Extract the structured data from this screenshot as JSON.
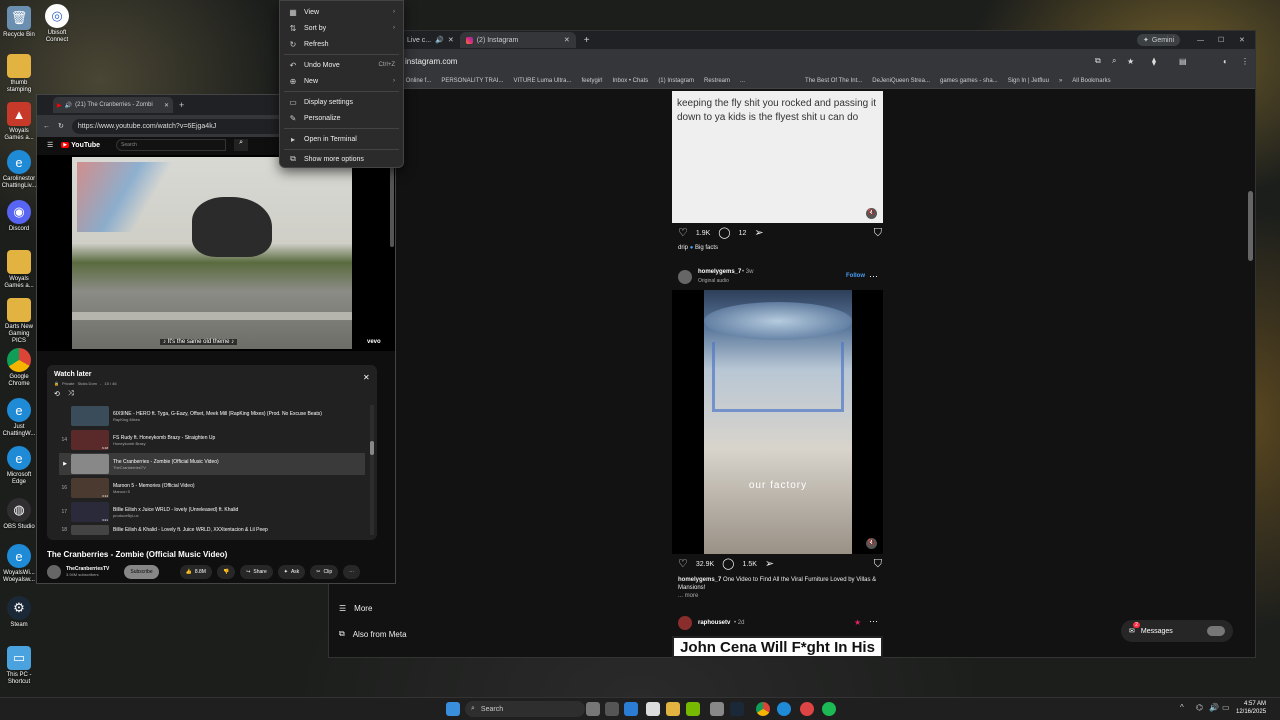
{
  "desktop": {
    "icons": [
      {
        "label": "Recycle Bin"
      },
      {
        "label": "thumb\nstamping"
      },
      {
        "label": "Woyals\nGames a..."
      },
      {
        "label": "Carolinestor\nChattingLiv..."
      },
      {
        "label": "Discord"
      },
      {
        "label": "Woyals\nGames a..."
      },
      {
        "label": "Darts New\nGaming PICS"
      },
      {
        "label": "Google\nChrome"
      },
      {
        "label": "Just\nChattingW..."
      },
      {
        "label": "Microsoft\nEdge"
      },
      {
        "label": "OBS Studio"
      },
      {
        "label": "WoyalsWi...\nWoeyalsw..."
      },
      {
        "label": "Steam"
      },
      {
        "label": "This PC -\nShortcut"
      }
    ],
    "ubisoft_label": "Ubisoft\nConnect"
  },
  "context_menu": {
    "items": [
      {
        "label": "View",
        "icon": "view-icon",
        "tail": "›"
      },
      {
        "label": "Sort by",
        "icon": "sort-icon",
        "tail": "›"
      },
      {
        "label": "Refresh",
        "icon": "refresh-icon",
        "tail": ""
      },
      {
        "label": "Undo Move",
        "icon": "undo-icon",
        "tail": "Ctrl+Z"
      },
      {
        "label": "New",
        "icon": "new-icon",
        "tail": "›"
      },
      {
        "label": "Display settings",
        "icon": "display-icon",
        "tail": ""
      },
      {
        "label": "Personalize",
        "icon": "personalize-icon",
        "tail": ""
      },
      {
        "label": "Open in Terminal",
        "icon": "terminal-icon",
        "tail": ""
      },
      {
        "label": "Show more options",
        "icon": "more-options-icon",
        "tail": ""
      }
    ]
  },
  "ig_browser": {
    "tabs": [
      {
        "label": "Live c..."
      },
      {
        "label": "(2) Instagram"
      }
    ],
    "gemini_label": "Gemini",
    "url": "instagram.com",
    "bookmarks": [
      "rs Online f...",
      "PERSONALITY TRAI...",
      "VITURE Luma Ultra...",
      "feetygirl",
      "Inbox • Chats",
      "(1) Instagram",
      "Restream",
      "...",
      "The Best Of The Int...",
      "DeJeniQueen Strea...",
      "games games - sha...",
      "Sign In | Jetfluu"
    ],
    "all_bookmarks": "All Bookmarks"
  },
  "instagram": {
    "post1": {
      "text": "keeping the fly shit you rocked and passing it down to ya kids is the flyest shit u can do",
      "likes": "1.9K",
      "comments": "12",
      "audio_user": "drip",
      "audio_name": "Big facts"
    },
    "post2": {
      "username": "homelygems_7",
      "age": "• 3w",
      "audio": "Original audio",
      "follow": "Follow",
      "overlay": "our factory",
      "likes": "32.9K",
      "comments": "1.5K",
      "caption_user": "homelygems_7",
      "caption": "One Video to Find All the Viral Furniture Loved by Villas & Mansions!",
      "more": "... more"
    },
    "post3": {
      "username": "raphousetv",
      "age": "• 2d",
      "headline": "John Cena Will F*ght In His"
    },
    "sidebar": {
      "more": "More",
      "meta": "Also from Meta"
    },
    "messages": "Messages",
    "messages_badge": "2"
  },
  "youtube": {
    "tab_label": "(21) The Cranberries - Zombi",
    "url": "https://www.youtube.com/watch?v=6Ejga4kJ",
    "logo": "YouTube",
    "search_placeholder": "Search",
    "subtitle": "♪ It's the same old theme ♪",
    "vevo": "vevo",
    "playlist": {
      "title": "Watch later",
      "privacy": "Private",
      "owner": "Stoks Dom",
      "position": "15 / 46",
      "items": [
        {
          "num": "",
          "title": "6IX9INE - HERO ft. Tyga, G-Eazy, Offset, Meek Mill (RapKing Mixes) (Prod. No Excuse Beats)",
          "channel": "RapKing Mixes",
          "dur": ""
        },
        {
          "num": "14",
          "title": "FS Rudy ft. Honeykomb Brazy - Straighten Up",
          "channel": "Honeykomb Brazy",
          "dur": "6:18"
        },
        {
          "num": "",
          "title": "The Cranberries - Zombie (Official Music Video)",
          "channel": "TheCranberriesTV",
          "dur": ""
        },
        {
          "num": "16",
          "title": "Maroon 5 - Memories (Official Video)",
          "channel": "Maroon 5",
          "dur": "3:14"
        },
        {
          "num": "17",
          "title": "Billie Eilish x Juice WRLD - lovely (Unreleased) ft. Khalid",
          "channel": "produceByLuc",
          "dur": "3:21"
        },
        {
          "num": "18",
          "title": "Billie Eilish & Khalid - Lovely ft. Juice WRLD, XXXtentacion & Lil Peep",
          "channel": "",
          "dur": ""
        }
      ]
    },
    "video_title": "The Cranberries - Zombie (Official Music Video)",
    "channel": "TheCranberriesTV",
    "subscribers": "3.94M subscribers",
    "subscribe": "Subscribe",
    "likes": "8.8M",
    "share": "Share",
    "ask": "Ask",
    "clip": "Clip"
  },
  "taskbar": {
    "search": "Search",
    "time": "4:57 AM",
    "date": "12/16/2025"
  }
}
